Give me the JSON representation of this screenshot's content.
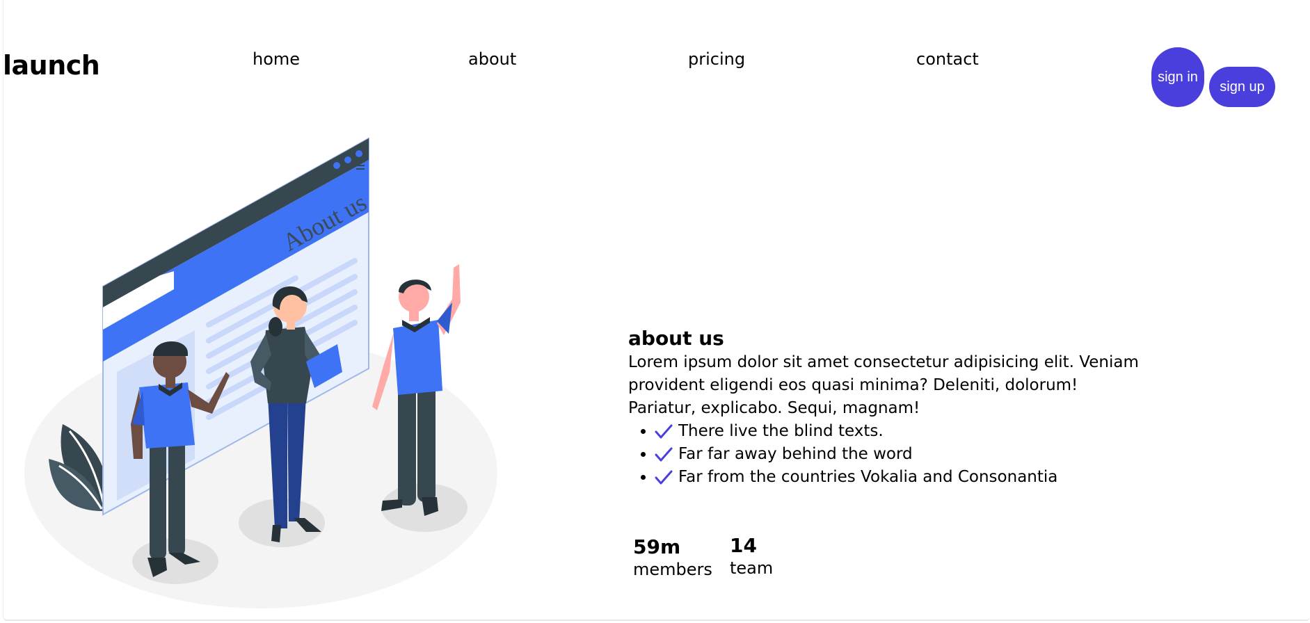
{
  "brand": {
    "logo": "launch"
  },
  "nav": {
    "items": [
      {
        "label": "home"
      },
      {
        "label": "about"
      },
      {
        "label": "pricing"
      },
      {
        "label": "contact"
      }
    ]
  },
  "auth": {
    "signin_label": "sign in",
    "signup_label": "sign up",
    "button_color": "#4a3fdc"
  },
  "illustration": {
    "browser_heading": "About us",
    "accent_color": "#3f73f5"
  },
  "about": {
    "title": "about us",
    "text": "Lorem ipsum dolor sit amet consectetur adipisicing elit. Veniam provident eligendi eos quasi minima? Deleniti, dolorum! Pariatur, explicabo. Sequi, magnam!",
    "features": [
      {
        "icon": "check-icon",
        "text": "There live the blind texts."
      },
      {
        "icon": "check-icon",
        "text": "Far far away behind the word"
      },
      {
        "icon": "check-icon",
        "text": "Far from the countries Vokalia and Consonantia"
      }
    ]
  },
  "stats": [
    {
      "value": "59m",
      "label": "members"
    },
    {
      "value": "14",
      "label": "team"
    }
  ]
}
